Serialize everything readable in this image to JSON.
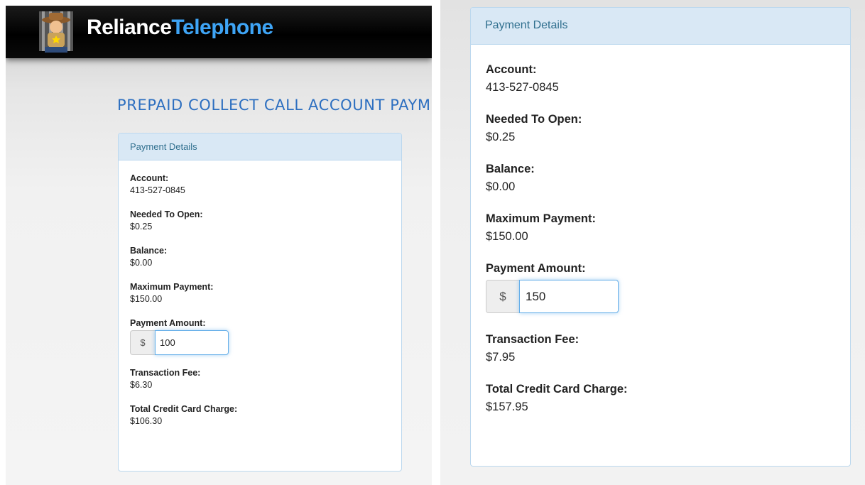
{
  "header": {
    "brand_part1": "Reliance",
    "brand_part2": "Telephone",
    "logo_icon": "sheriff-mascot-icon"
  },
  "page_title": "PREPAID COLLECT CALL ACCOUNT PAYMEN",
  "colors": {
    "brand_blue": "#3ea4f5",
    "title_blue": "#2d6fc0",
    "panel_heading_bg": "#d9e8f5",
    "panel_heading_text": "#31708f",
    "input_focus_border": "#66afe9"
  },
  "left_panel": {
    "heading": "Payment Details",
    "account_label": "Account:",
    "account_value": "413-527-0845",
    "needed_label": "Needed To Open:",
    "needed_value": "$0.25",
    "balance_label": "Balance:",
    "balance_value": "$0.00",
    "max_label": "Maximum Payment:",
    "max_value": "$150.00",
    "amount_label": "Payment Amount:",
    "currency_addon": "$",
    "amount_value": "100",
    "fee_label": "Transaction Fee:",
    "fee_value": "$6.30",
    "total_label": "Total Credit Card Charge:",
    "total_value": "$106.30"
  },
  "right_panel": {
    "heading": "Payment Details",
    "account_label": "Account:",
    "account_value": "413-527-0845",
    "needed_label": "Needed To Open:",
    "needed_value": "$0.25",
    "balance_label": "Balance:",
    "balance_value": "$0.00",
    "max_label": "Maximum Payment:",
    "max_value": "$150.00",
    "amount_label": "Payment Amount:",
    "currency_addon": "$",
    "amount_value": "150",
    "fee_label": "Transaction Fee:",
    "fee_value": "$7.95",
    "total_label": "Total Credit Card Charge:",
    "total_value": "$157.95"
  }
}
